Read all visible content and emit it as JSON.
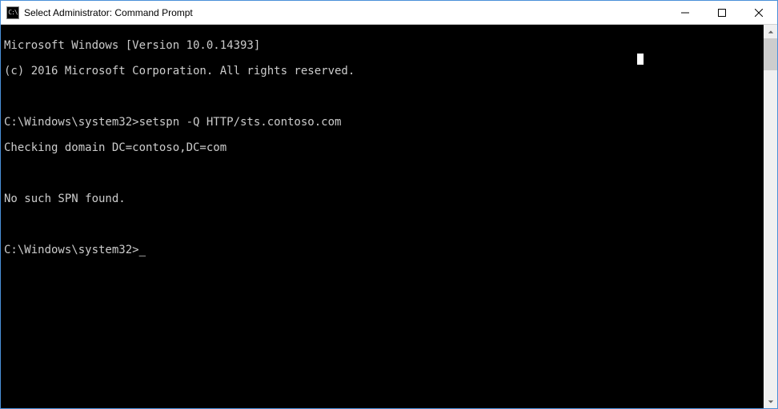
{
  "window": {
    "title": "Select Administrator: Command Prompt"
  },
  "terminal": {
    "lines": [
      "Microsoft Windows [Version 10.0.14393]",
      "(c) 2016 Microsoft Corporation. All rights reserved.",
      "",
      "C:\\Windows\\system32>setspn -Q HTTP/sts.contoso.com",
      "Checking domain DC=contoso,DC=com",
      "",
      "No such SPN found.",
      ""
    ],
    "prompt": "C:\\Windows\\system32>"
  }
}
